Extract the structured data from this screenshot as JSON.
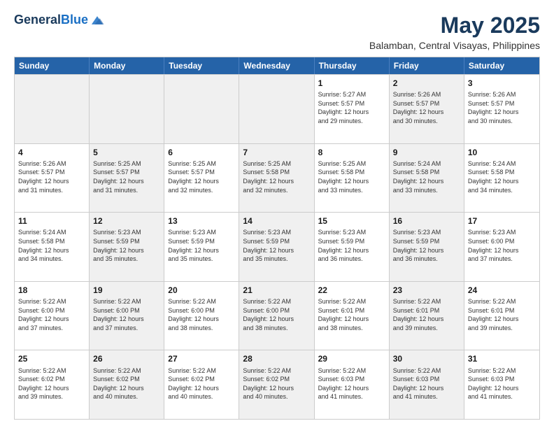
{
  "logo": {
    "general": "General",
    "blue": "Blue"
  },
  "header": {
    "title": "May 2025",
    "subtitle": "Balamban, Central Visayas, Philippines"
  },
  "weekdays": [
    "Sunday",
    "Monday",
    "Tuesday",
    "Wednesday",
    "Thursday",
    "Friday",
    "Saturday"
  ],
  "rows": [
    [
      {
        "day": "",
        "info": "",
        "shaded": true
      },
      {
        "day": "",
        "info": "",
        "shaded": true
      },
      {
        "day": "",
        "info": "",
        "shaded": true
      },
      {
        "day": "",
        "info": "",
        "shaded": true
      },
      {
        "day": "1",
        "info": "Sunrise: 5:27 AM\nSunset: 5:57 PM\nDaylight: 12 hours\nand 29 minutes.",
        "shaded": false
      },
      {
        "day": "2",
        "info": "Sunrise: 5:26 AM\nSunset: 5:57 PM\nDaylight: 12 hours\nand 30 minutes.",
        "shaded": true
      },
      {
        "day": "3",
        "info": "Sunrise: 5:26 AM\nSunset: 5:57 PM\nDaylight: 12 hours\nand 30 minutes.",
        "shaded": false
      }
    ],
    [
      {
        "day": "4",
        "info": "Sunrise: 5:26 AM\nSunset: 5:57 PM\nDaylight: 12 hours\nand 31 minutes.",
        "shaded": false
      },
      {
        "day": "5",
        "info": "Sunrise: 5:25 AM\nSunset: 5:57 PM\nDaylight: 12 hours\nand 31 minutes.",
        "shaded": true
      },
      {
        "day": "6",
        "info": "Sunrise: 5:25 AM\nSunset: 5:57 PM\nDaylight: 12 hours\nand 32 minutes.",
        "shaded": false
      },
      {
        "day": "7",
        "info": "Sunrise: 5:25 AM\nSunset: 5:58 PM\nDaylight: 12 hours\nand 32 minutes.",
        "shaded": true
      },
      {
        "day": "8",
        "info": "Sunrise: 5:25 AM\nSunset: 5:58 PM\nDaylight: 12 hours\nand 33 minutes.",
        "shaded": false
      },
      {
        "day": "9",
        "info": "Sunrise: 5:24 AM\nSunset: 5:58 PM\nDaylight: 12 hours\nand 33 minutes.",
        "shaded": true
      },
      {
        "day": "10",
        "info": "Sunrise: 5:24 AM\nSunset: 5:58 PM\nDaylight: 12 hours\nand 34 minutes.",
        "shaded": false
      }
    ],
    [
      {
        "day": "11",
        "info": "Sunrise: 5:24 AM\nSunset: 5:58 PM\nDaylight: 12 hours\nand 34 minutes.",
        "shaded": false
      },
      {
        "day": "12",
        "info": "Sunrise: 5:23 AM\nSunset: 5:59 PM\nDaylight: 12 hours\nand 35 minutes.",
        "shaded": true
      },
      {
        "day": "13",
        "info": "Sunrise: 5:23 AM\nSunset: 5:59 PM\nDaylight: 12 hours\nand 35 minutes.",
        "shaded": false
      },
      {
        "day": "14",
        "info": "Sunrise: 5:23 AM\nSunset: 5:59 PM\nDaylight: 12 hours\nand 35 minutes.",
        "shaded": true
      },
      {
        "day": "15",
        "info": "Sunrise: 5:23 AM\nSunset: 5:59 PM\nDaylight: 12 hours\nand 36 minutes.",
        "shaded": false
      },
      {
        "day": "16",
        "info": "Sunrise: 5:23 AM\nSunset: 5:59 PM\nDaylight: 12 hours\nand 36 minutes.",
        "shaded": true
      },
      {
        "day": "17",
        "info": "Sunrise: 5:23 AM\nSunset: 6:00 PM\nDaylight: 12 hours\nand 37 minutes.",
        "shaded": false
      }
    ],
    [
      {
        "day": "18",
        "info": "Sunrise: 5:22 AM\nSunset: 6:00 PM\nDaylight: 12 hours\nand 37 minutes.",
        "shaded": false
      },
      {
        "day": "19",
        "info": "Sunrise: 5:22 AM\nSunset: 6:00 PM\nDaylight: 12 hours\nand 37 minutes.",
        "shaded": true
      },
      {
        "day": "20",
        "info": "Sunrise: 5:22 AM\nSunset: 6:00 PM\nDaylight: 12 hours\nand 38 minutes.",
        "shaded": false
      },
      {
        "day": "21",
        "info": "Sunrise: 5:22 AM\nSunset: 6:00 PM\nDaylight: 12 hours\nand 38 minutes.",
        "shaded": true
      },
      {
        "day": "22",
        "info": "Sunrise: 5:22 AM\nSunset: 6:01 PM\nDaylight: 12 hours\nand 38 minutes.",
        "shaded": false
      },
      {
        "day": "23",
        "info": "Sunrise: 5:22 AM\nSunset: 6:01 PM\nDaylight: 12 hours\nand 39 minutes.",
        "shaded": true
      },
      {
        "day": "24",
        "info": "Sunrise: 5:22 AM\nSunset: 6:01 PM\nDaylight: 12 hours\nand 39 minutes.",
        "shaded": false
      }
    ],
    [
      {
        "day": "25",
        "info": "Sunrise: 5:22 AM\nSunset: 6:02 PM\nDaylight: 12 hours\nand 39 minutes.",
        "shaded": false
      },
      {
        "day": "26",
        "info": "Sunrise: 5:22 AM\nSunset: 6:02 PM\nDaylight: 12 hours\nand 40 minutes.",
        "shaded": true
      },
      {
        "day": "27",
        "info": "Sunrise: 5:22 AM\nSunset: 6:02 PM\nDaylight: 12 hours\nand 40 minutes.",
        "shaded": false
      },
      {
        "day": "28",
        "info": "Sunrise: 5:22 AM\nSunset: 6:02 PM\nDaylight: 12 hours\nand 40 minutes.",
        "shaded": true
      },
      {
        "day": "29",
        "info": "Sunrise: 5:22 AM\nSunset: 6:03 PM\nDaylight: 12 hours\nand 41 minutes.",
        "shaded": false
      },
      {
        "day": "30",
        "info": "Sunrise: 5:22 AM\nSunset: 6:03 PM\nDaylight: 12 hours\nand 41 minutes.",
        "shaded": true
      },
      {
        "day": "31",
        "info": "Sunrise: 5:22 AM\nSunset: 6:03 PM\nDaylight: 12 hours\nand 41 minutes.",
        "shaded": false
      }
    ]
  ]
}
